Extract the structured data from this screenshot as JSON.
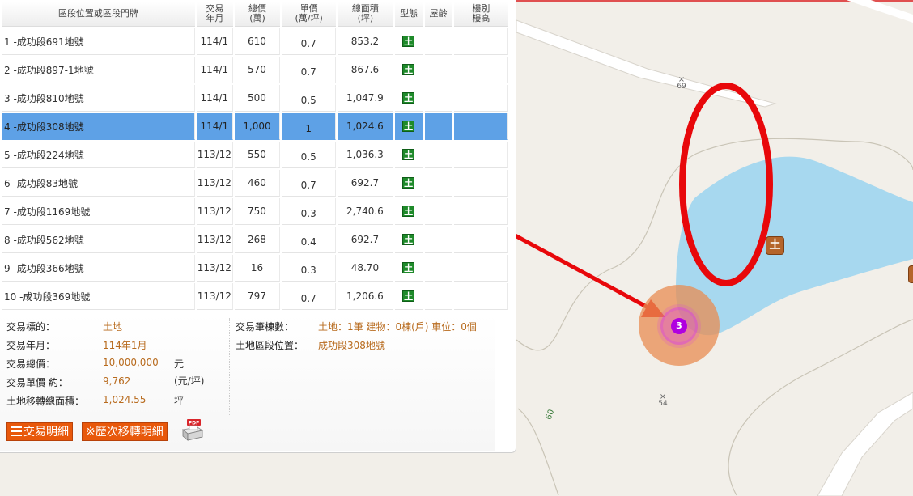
{
  "table": {
    "headers": [
      {
        "line1": "區段位置或區段門牌",
        "line2": ""
      },
      {
        "line1": "交易",
        "line2": "年月"
      },
      {
        "line1": "總價",
        "line2": "(萬)"
      },
      {
        "line1": "單價",
        "line2": "(萬/坪)"
      },
      {
        "line1": "總面積",
        "line2": "(坪)"
      },
      {
        "line1": "型態",
        "line2": ""
      },
      {
        "line1": "屋齡",
        "line2": ""
      },
      {
        "line1": "樓別",
        "line2": "樓高"
      }
    ],
    "rows": [
      {
        "location": "1 -成功段691地號",
        "date": "114/1",
        "total": "610",
        "unit": "0.7",
        "area": "853.2",
        "type": "土",
        "selected": false
      },
      {
        "location": "2 -成功段897-1地號",
        "date": "114/1",
        "total": "570",
        "unit": "0.7",
        "area": "867.6",
        "type": "土",
        "selected": false
      },
      {
        "location": "3 -成功段810地號",
        "date": "114/1",
        "total": "500",
        "unit": "0.5",
        "area": "1,047.9",
        "type": "土",
        "selected": false
      },
      {
        "location": "4 -成功段308地號",
        "date": "114/1",
        "total": "1,000",
        "unit": "1",
        "area": "1,024.6",
        "type": "土",
        "selected": true
      },
      {
        "location": "5 -成功段224地號",
        "date": "113/12",
        "total": "550",
        "unit": "0.5",
        "area": "1,036.3",
        "type": "土",
        "selected": false
      },
      {
        "location": "6 -成功段83地號",
        "date": "113/12",
        "total": "460",
        "unit": "0.7",
        "area": "692.7",
        "type": "土",
        "selected": false
      },
      {
        "location": "7 -成功段1169地號",
        "date": "113/12",
        "total": "750",
        "unit": "0.3",
        "area": "2,740.6",
        "type": "土",
        "selected": false
      },
      {
        "location": "8 -成功段562地號",
        "date": "113/12",
        "total": "268",
        "unit": "0.4",
        "area": "692.7",
        "type": "土",
        "selected": false
      },
      {
        "location": "9 -成功段366地號",
        "date": "113/12",
        "total": "16",
        "unit": "0.3",
        "area": "48.70",
        "type": "土",
        "selected": false
      },
      {
        "location": "10 -成功段369地號",
        "date": "113/12",
        "total": "797",
        "unit": "0.7",
        "area": "1,206.6",
        "type": "土",
        "selected": false
      }
    ]
  },
  "detail": {
    "target_label": "交易標的：",
    "target_value": "土地",
    "date_label": "交易年月：",
    "date_value": "114年1月",
    "total_label": "交易總價：",
    "total_value": "10,000,000",
    "total_unit": "元",
    "unit_label": "交易單價 約：",
    "unit_value": "9,762",
    "unit_unit": "(元/坪)",
    "area_label": "土地移轉總面積：",
    "area_value": "1,024.55",
    "area_unit": "坪",
    "count_label": "交易筆棟數：",
    "count_value": "土地：1筆 建物：0棟(戶) 車位：0個",
    "position_label": "土地區段位置：",
    "position_value": "成功段308地號"
  },
  "buttons": {
    "detail_label": "交易明細",
    "history_label": "※歷次移轉明細",
    "pdf_badge": "PDF"
  },
  "map": {
    "label_69": "69",
    "label_54": "54",
    "label_60": "60",
    "land_marker": "土",
    "cluster_count": "3",
    "colors": {
      "water": "#a7d8ef",
      "cluster": "#e88c52",
      "cluster_core": "#b000e0",
      "annotation": "#e8080b",
      "selected_row": "#5ea1e6"
    }
  }
}
